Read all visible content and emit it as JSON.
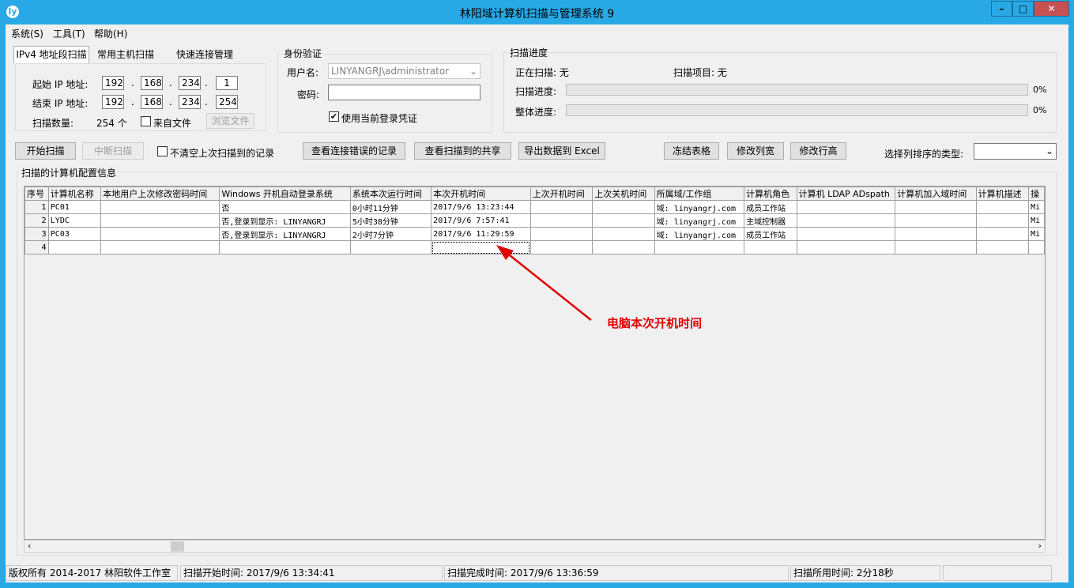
{
  "window": {
    "title": "林阳域计算机扫描与管理系统 9",
    "icon": "ly-app-icon"
  },
  "menu": [
    "系统(S)",
    "工具(T)",
    "帮助(H)"
  ],
  "tabs": [
    "IPv4 地址段扫描",
    "常用主机扫描",
    "快速连接管理"
  ],
  "scan": {
    "start_label": "起始 IP 地址:",
    "end_label": "结束 IP 地址:",
    "start_ip": [
      "192",
      "168",
      "234",
      "1"
    ],
    "end_ip": [
      "192",
      "168",
      "234",
      "254"
    ],
    "dot": ".",
    "count_label": "扫描数量:",
    "count_value": "254 个",
    "from_file_label": "来自文件",
    "browse_label": "浏览文件"
  },
  "auth": {
    "group_label": "身份验证",
    "user_label": "用户名:",
    "user_value": "LINYANGRJ\\administrator",
    "password_label": "密码:",
    "password_value": "",
    "use_current_label": "使用当前登录凭证",
    "use_current_checked": "✔"
  },
  "progress": {
    "group_label": "扫描进度",
    "scanning_label": "正在扫描: 无",
    "item_label": "扫描项目: 无",
    "scan_progress_label": "扫描进度:",
    "scan_progress_pct": "0%",
    "total_progress_label": "整体进度:",
    "total_progress_pct": "0%"
  },
  "toolbar": {
    "start": "开始扫描",
    "stop": "中断扫描",
    "keep_label": "不清空上次扫描到的记录",
    "view_errors": "查看连接错误的记录",
    "view_shares": "查看扫描到的共享",
    "export_excel": "导出数据到 Excel",
    "freeze": "冻结表格",
    "col_width": "修改列宽",
    "row_height": "修改行高",
    "sort_label": "选择列排序的类型:",
    "sort_value": ""
  },
  "grid": {
    "group_label": "扫描的计算机配置信息",
    "columns": [
      "序号",
      "计算机名称",
      "本地用户上次修改密码时间",
      "Windows 开机自动登录系统",
      "系统本次运行时间",
      "本次开机时间",
      "上次开机时间",
      "上次关机时间",
      "所属域/工作组",
      "计算机角色",
      "计算机 LDAP ADspath",
      "计算机加入域时间",
      "计算机描述",
      "操"
    ],
    "rows": [
      [
        "1",
        "PC01",
        "",
        "否",
        "0小时11分钟",
        "2017/9/6 13:23:44",
        "",
        "",
        "域: linyangrj.com",
        "成员工作站",
        "",
        "",
        "",
        "Mi"
      ],
      [
        "2",
        "LYDC",
        "",
        "否,登录到显示: LINYANGRJ",
        "5小时38分钟",
        "2017/9/6 7:57:41",
        "",
        "",
        "域: linyangrj.com",
        "主域控制器",
        "",
        "",
        "",
        "Mi"
      ],
      [
        "3",
        "PC03",
        "",
        "否,登录到显示: LINYANGRJ",
        "2小时7分钟",
        "2017/9/6 11:29:59",
        "",
        "",
        "域: linyangrj.com",
        "成员工作站",
        "",
        "",
        "",
        "Mi"
      ],
      [
        "4",
        "",
        "",
        "",
        "",
        "",
        "",
        "",
        "",
        "",
        "",
        "",
        "",
        ""
      ]
    ]
  },
  "annotation": {
    "text": "电脑本次开机时间",
    "color": "#e00000"
  },
  "status": {
    "copyright": "版权所有 2014-2017 林阳软件工作室",
    "start_time": "扫描开始时间: 2017/9/6 13:34:41",
    "end_time": "扫描完成时间: 2017/9/6 13:36:59",
    "elapsed": "扫描所用时间: 2分18秒"
  }
}
